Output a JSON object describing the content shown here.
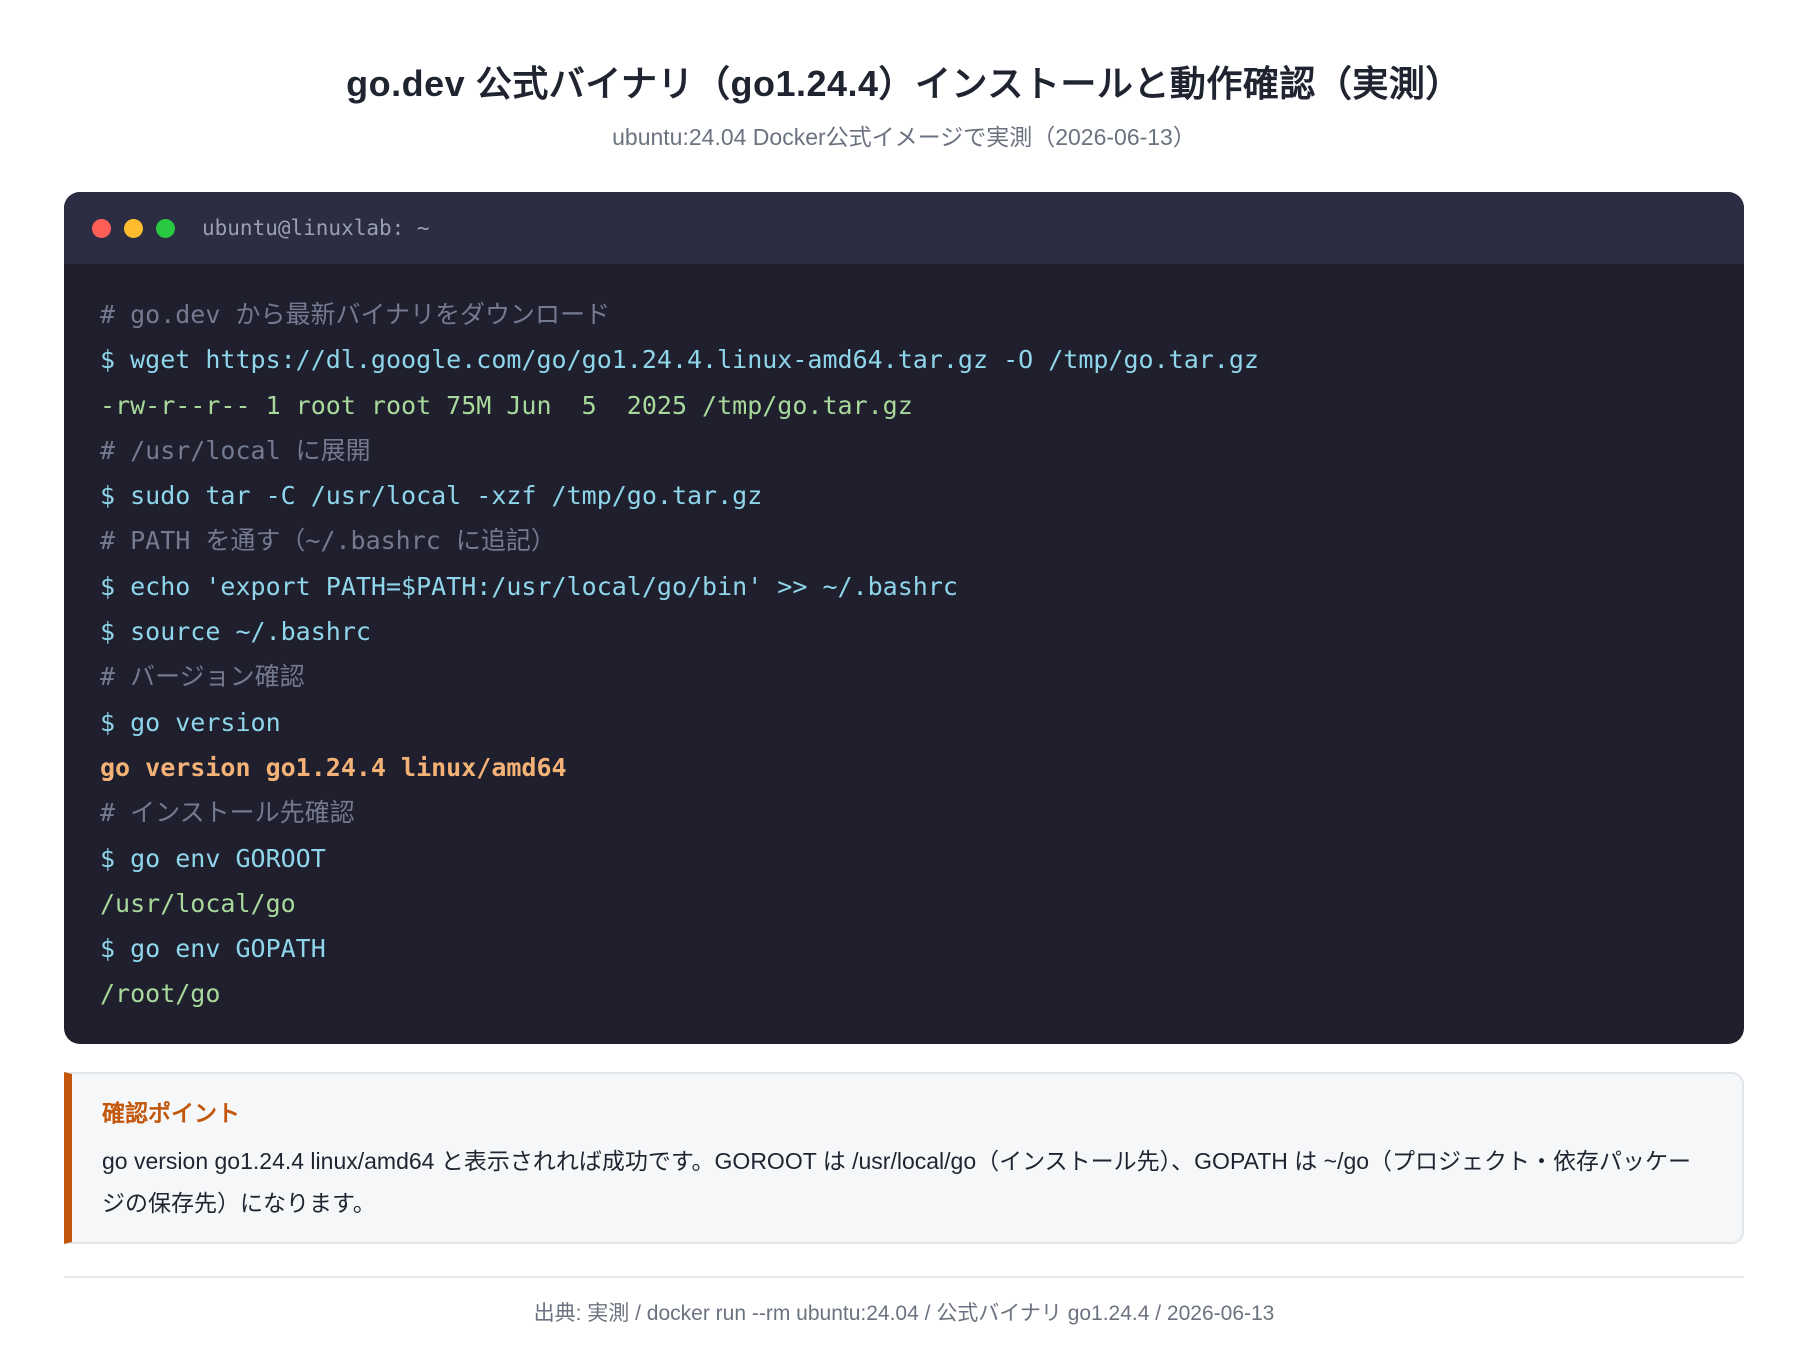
{
  "header": {
    "title": "go.dev 公式バイナリ（go1.24.4）インストールと動作確認（実測）",
    "subtitle": "ubuntu:24.04 Docker公式イメージで実測（2026-06-13）"
  },
  "terminal": {
    "window_title": "ubuntu@linuxlab: ~",
    "lines": [
      {
        "type": "comment",
        "text": "# go.dev から最新バイナリをダウンロード"
      },
      {
        "type": "command",
        "text": "$ wget https://dl.google.com/go/go1.24.4.linux-amd64.tar.gz -O /tmp/go.tar.gz"
      },
      {
        "type": "output",
        "text": "-rw-r--r-- 1 root root 75M Jun  5  2025 /tmp/go.tar.gz"
      },
      {
        "type": "comment",
        "text": "# /usr/local に展開"
      },
      {
        "type": "command",
        "text": "$ sudo tar -C /usr/local -xzf /tmp/go.tar.gz"
      },
      {
        "type": "comment",
        "text": "# PATH を通す（~/.bashrc に追記）"
      },
      {
        "type": "command",
        "text": "$ echo 'export PATH=$PATH:/usr/local/go/bin' >> ~/.bashrc"
      },
      {
        "type": "command",
        "text": "$ source ~/.bashrc"
      },
      {
        "type": "comment",
        "text": "# バージョン確認"
      },
      {
        "type": "command",
        "text": "$ go version"
      },
      {
        "type": "highlight",
        "text": "go version go1.24.4 linux/amd64"
      },
      {
        "type": "comment",
        "text": "# インストール先確認"
      },
      {
        "type": "command",
        "text": "$ go env GOROOT"
      },
      {
        "type": "output",
        "text": "/usr/local/go"
      },
      {
        "type": "command",
        "text": "$ go env GOPATH"
      },
      {
        "type": "output",
        "text": "/root/go"
      }
    ]
  },
  "callout": {
    "title": "確認ポイント",
    "text": "go version go1.24.4 linux/amd64 と表示されれば成功です。GOROOT は /usr/local/go（インストール先）、GOPATH は ~/go（プロジェクト・依存パッケージの保存先）になります。"
  },
  "footer": {
    "text": "出典: 実測 / docker run --rm ubuntu:24.04 / 公式バイナリ go1.24.4 / 2026-06-13"
  },
  "colors": {
    "terminal_bg": "#1f1f2e",
    "terminal_bar": "#2c2d42",
    "comment": "#747a8f",
    "command": "#8fd6ea",
    "output": "#a8d99a",
    "highlight": "#f5b277",
    "accent": "#c2570c"
  }
}
